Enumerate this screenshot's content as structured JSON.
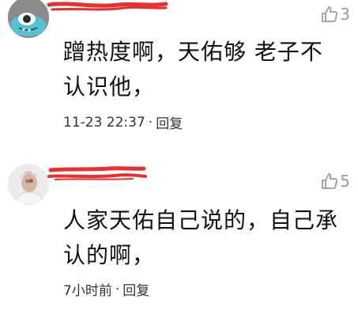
{
  "comments": [
    {
      "likes": "3",
      "text": "蹭热度啊，天佑够 老子不认识他，",
      "time": "11-23 22:37",
      "separator": "·",
      "reply_label": "回复"
    },
    {
      "likes": "5",
      "text": "人家天佑自己说的，自己承认的啊，",
      "time": "7小时前",
      "separator": "·",
      "reply_label": "回复"
    }
  ],
  "icons": {
    "like": "thumbs-up-icon"
  },
  "colors": {
    "redaction": "#e8312f",
    "muted": "#9b9b9b",
    "text": "#111111"
  }
}
